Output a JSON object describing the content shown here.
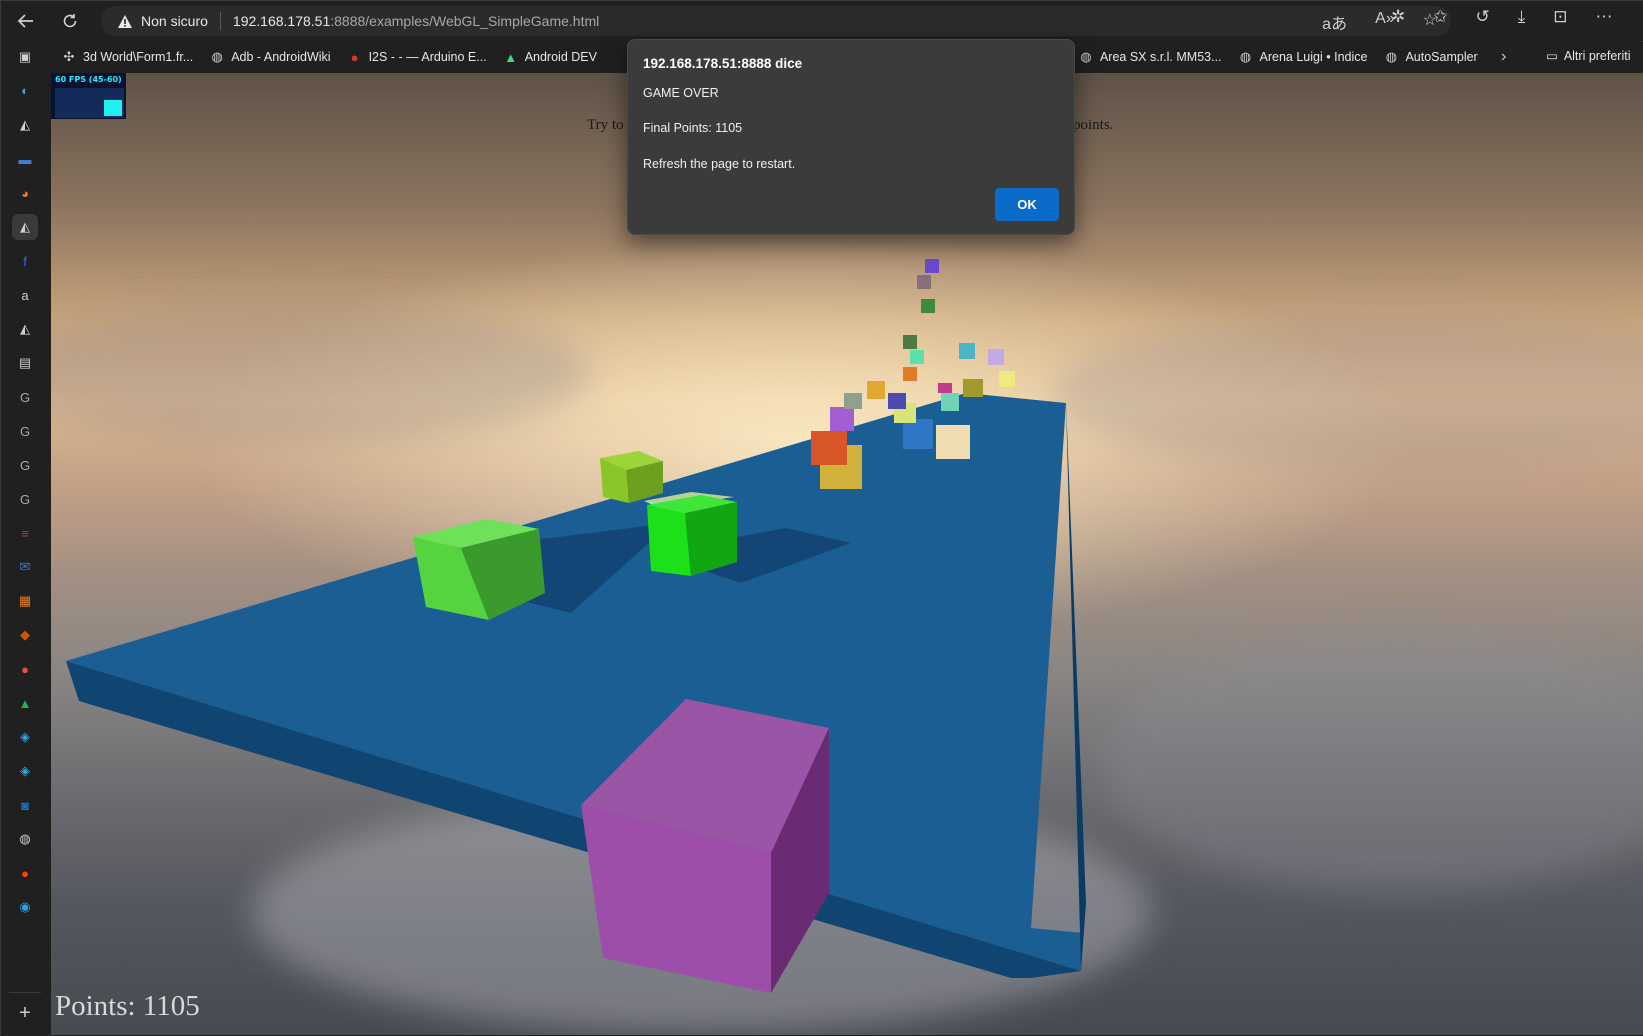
{
  "toolbar": {
    "security_label": "Non sicuro",
    "url_host": "192.168.178.51",
    "url_rest": ":8888/examples/WebGL_SimpleGame.html"
  },
  "bookmarks": [
    {
      "label": "3d World\\Form1.fr...",
      "icon": "puzzle-icon"
    },
    {
      "label": "Adb - AndroidWiki",
      "icon": "globe-icon"
    },
    {
      "label": "I2S - - — Arduino E...",
      "icon": "arduino-icon"
    },
    {
      "label": "Android DEV",
      "icon": "android-icon"
    },
    {
      "label": "Area SX s.r.l. MM53...",
      "icon": "globe-icon"
    },
    {
      "label": "Arena Luigi • Indice",
      "icon": "globe-icon"
    },
    {
      "label": "AutoSampler",
      "icon": "globe-icon"
    }
  ],
  "bookmarks_other": "Altri preferiti",
  "stats": {
    "fps_label": "60 FPS (45-60)"
  },
  "game": {
    "instructions": [
      "Try to",
      "points."
    ],
    "points_text": "Points: 1105"
  },
  "dialog": {
    "title": "192.168.178.51:8888 dice",
    "line1": "GAME OVER",
    "line2": "Final Points: 1105",
    "line3": "Refresh the page to restart.",
    "ok_label": "OK"
  },
  "colors": {
    "platform_top": "#1a5e93",
    "platform_side": "#0f4570",
    "ok_button": "#0a6bc9",
    "points_text": "#d9d9d9"
  }
}
